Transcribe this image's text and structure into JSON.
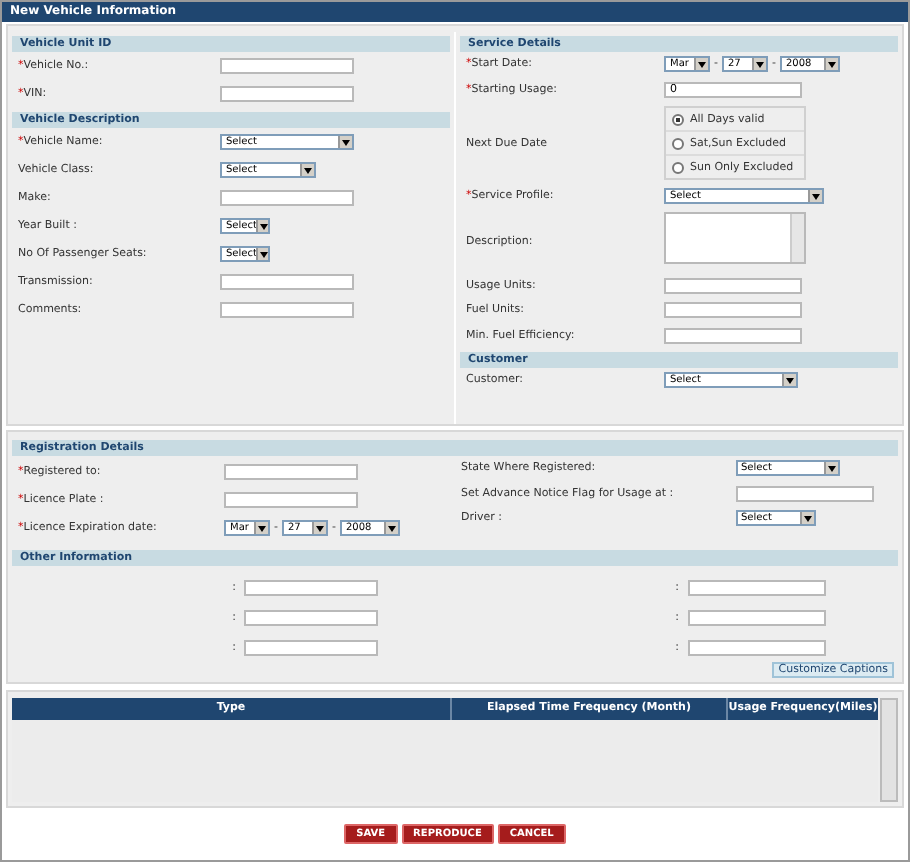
{
  "window": {
    "title": "New Vehicle Information"
  },
  "columns": [
    [
      {
        "title": "Vehicle Unit ID",
        "fields": [
          {
            "kind": "text",
            "marker": "*",
            "label": "Vehicle No.:"
          },
          {
            "kind": "text",
            "marker": "*",
            "label": "VIN:"
          }
        ]
      },
      {
        "title": "Vehicle Description",
        "fields": [
          {
            "kind": "select",
            "marker": "*",
            "label": "Vehicle Name:",
            "value": "Select"
          },
          {
            "kind": "select-medium",
            "label": "Vehicle Class:",
            "value": "Select"
          },
          {
            "kind": "text",
            "label": "Make:"
          },
          {
            "kind": "select-small",
            "label": "Year Built :",
            "value": "Select"
          },
          {
            "kind": "select-small",
            "label": "No Of Passenger Seats:",
            "value": "Select"
          },
          {
            "kind": "text",
            "label": "Transmission:"
          },
          {
            "kind": "text",
            "label": "Comments:"
          }
        ]
      }
    ],
    [
      {
        "title": "Service Details",
        "fields": [
          {
            "kind": "date",
            "marker": "*",
            "label": "Start Date:",
            "parts": [
              "Mar",
              "27",
              "2008"
            ],
            "separator": "-"
          },
          {
            "kind": "text",
            "marker": "*",
            "label": "Starting Usage:",
            "value": "0"
          },
          {
            "kind": "radio",
            "label": "Next Due Date",
            "options": [
              {
                "label": "All Days valid",
                "selected": true
              },
              {
                "label": "Sat,Sun Excluded",
                "selected": false
              },
              {
                "label": "Sun Only Excluded",
                "selected": false
              }
            ]
          },
          {
            "kind": "select-wide",
            "marker": "*",
            "label": "Service Profile:",
            "value": "Select"
          },
          {
            "kind": "textarea",
            "label": "Description:"
          },
          {
            "kind": "text",
            "label": "Usage Units:"
          },
          {
            "kind": "text",
            "label": "Fuel Units:"
          },
          {
            "kind": "text",
            "label": "Min. Fuel Efficiency:"
          }
        ]
      },
      {
        "title": "Customer",
        "fields": [
          {
            "kind": "select",
            "label": "Customer:",
            "value": "Select"
          }
        ]
      }
    ]
  ],
  "registration": {
    "title": "Registration Details",
    "left": [
      {
        "kind": "text",
        "marker": "*",
        "label": "Registered to:"
      },
      {
        "kind": "text",
        "marker": "*",
        "label": "Licence Plate :"
      },
      {
        "kind": "date",
        "marker": "*",
        "label": "Licence Expiration date:",
        "parts": [
          "Mar",
          "27",
          "2008"
        ],
        "separator": "-"
      }
    ],
    "right": [
      {
        "kind": "select-medium",
        "label": "State Where Registered:",
        "value": "Select"
      },
      {
        "kind": "text",
        "label": "Set Advance Notice Flag for Usage at :"
      },
      {
        "kind": "select-medium",
        "label": "Driver :",
        "value": "Select"
      }
    ]
  },
  "other_information": {
    "title": "Other Information",
    "left": [
      {
        "label": ":"
      },
      {
        "label": ":"
      },
      {
        "label": ":"
      }
    ],
    "right": [
      {
        "label": ":"
      },
      {
        "label": ":"
      },
      {
        "label": ":"
      }
    ],
    "button": "Customize Captions"
  },
  "table": {
    "columns": [
      "Type",
      "Elapsed Time Frequency (Month)",
      "Usage Frequency(Miles)"
    ]
  },
  "buttons": [
    "SAVE",
    "REPRODUCE",
    "CANCEL"
  ]
}
